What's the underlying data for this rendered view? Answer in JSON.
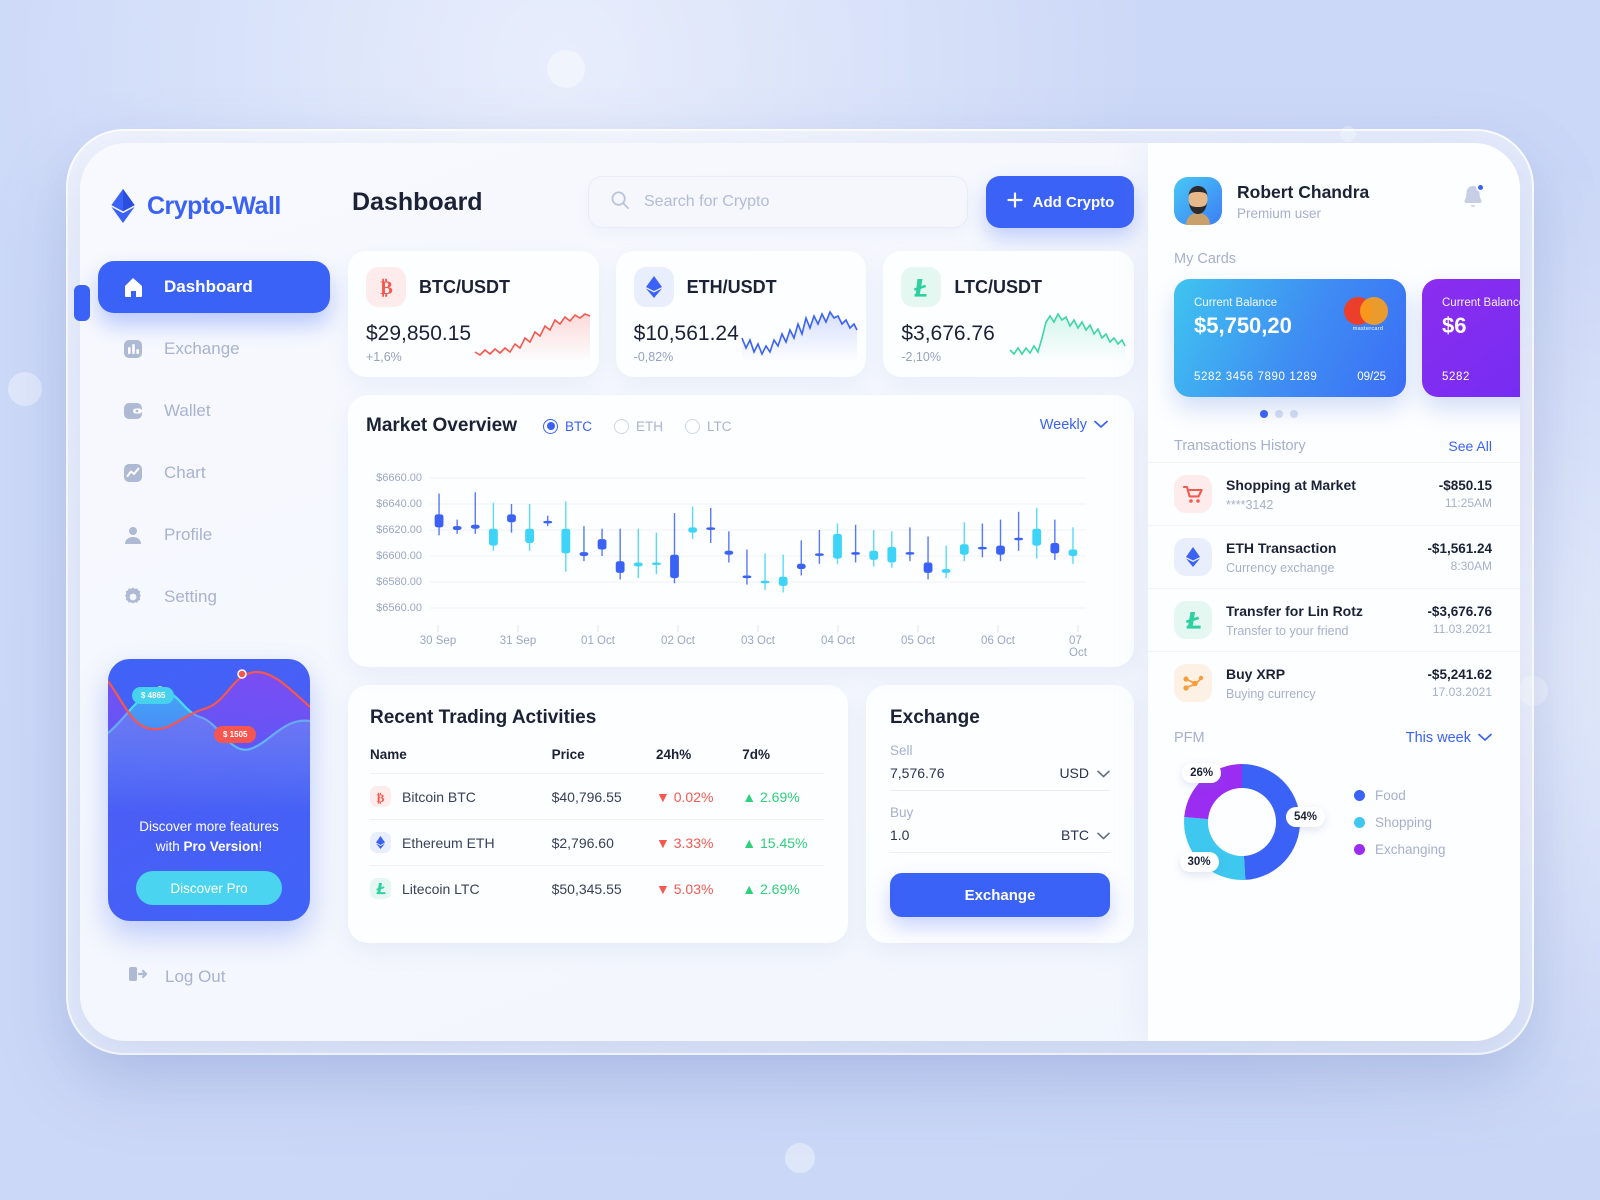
{
  "brand": {
    "name": "Crypto-Wall",
    "logo_icon": "ethereum-logo-icon",
    "accent": "#3b62f6"
  },
  "sidebar": {
    "items": [
      {
        "label": "Dashboard",
        "icon": "home-icon",
        "active": true
      },
      {
        "label": "Exchange",
        "icon": "bar-chart-icon",
        "active": false
      },
      {
        "label": "Wallet",
        "icon": "wallet-icon",
        "active": false
      },
      {
        "label": "Chart",
        "icon": "line-chart-icon",
        "active": false
      },
      {
        "label": "Profile",
        "icon": "user-icon",
        "active": false
      },
      {
        "label": "Setting",
        "icon": "gear-icon",
        "active": false
      }
    ],
    "promo": {
      "pill_high": "$ 4865",
      "pill_low": "$ 1505",
      "text_a": "Discover more features",
      "text_b": "with ",
      "text_bold": "Pro Version",
      "text_c": "!",
      "button": "Discover Pro"
    },
    "logout": {
      "label": "Log Out",
      "icon": "logout-icon"
    }
  },
  "header": {
    "title": "Dashboard",
    "search": {
      "placeholder": "Search for Crypto",
      "value": "",
      "icon": "search-icon"
    },
    "add_button": {
      "label": "Add Crypto",
      "icon": "plus-icon"
    }
  },
  "coin_cards": [
    {
      "pair": "BTC/USDT",
      "price": "$29,850.15",
      "change": "+1,6%",
      "icon": "bitcoin-icon",
      "color": "#f4584f",
      "bg": "#fdeceb"
    },
    {
      "pair": "ETH/USDT",
      "price": "$10,561.24",
      "change": "-0,82%",
      "icon": "ethereum-icon",
      "color": "#3b62f6",
      "bg": "#e9eefd"
    },
    {
      "pair": "LTC/USDT",
      "price": "$3,676.76",
      "change": "-2,10%",
      "icon": "litecoin-icon",
      "color": "#2ed0a0",
      "bg": "#e4f8f1"
    }
  ],
  "market": {
    "title": "Market Overview",
    "filters": [
      {
        "label": "BTC",
        "selected": true
      },
      {
        "label": "ETH",
        "selected": false
      },
      {
        "label": "LTC",
        "selected": false
      }
    ],
    "range": {
      "label": "Weekly",
      "icon": "chevron-down-icon"
    }
  },
  "chart_data": {
    "type": "candlestick",
    "title": "Market Overview",
    "xlabel": "",
    "ylabel": "",
    "ylim": [
      6550,
      6670
    ],
    "grid": true,
    "ytick_labels": [
      "$6660.00",
      "$6640.00",
      "$6620.00",
      "$6600.00",
      "$6580.00",
      "$6560.00"
    ],
    "ytick_values": [
      6660,
      6640,
      6620,
      6600,
      6580,
      6560
    ],
    "xtick_labels": [
      "30 Sep",
      "31 Sep",
      "01 Oct",
      "02 Oct",
      "03 Oct",
      "04 Oct",
      "05 Oct",
      "06 Oct",
      "07 Oct"
    ],
    "colors": {
      "up": "#3b62f6",
      "down": "#3ed4f7"
    },
    "candles": [
      {
        "open": 6622,
        "close": 6632,
        "high": 6648,
        "low": 6616,
        "dir": "up"
      },
      {
        "open": 6620,
        "close": 6623,
        "high": 6628,
        "low": 6617,
        "dir": "up"
      },
      {
        "open": 6621,
        "close": 6624,
        "high": 6649,
        "low": 6617,
        "dir": "up"
      },
      {
        "open": 6621,
        "close": 6608,
        "high": 6641,
        "low": 6604,
        "dir": "down"
      },
      {
        "open": 6626,
        "close": 6632,
        "high": 6640,
        "low": 6618,
        "dir": "up"
      },
      {
        "open": 6621,
        "close": 6610,
        "high": 6640,
        "low": 6604,
        "dir": "down"
      },
      {
        "open": 6627,
        "close": 6627,
        "high": 6631,
        "low": 6623,
        "dir": "up"
      },
      {
        "open": 6621,
        "close": 6602,
        "high": 6642,
        "low": 6588,
        "dir": "down"
      },
      {
        "open": 6603,
        "close": 6600,
        "high": 6623,
        "low": 6596,
        "dir": "up"
      },
      {
        "open": 6613,
        "close": 6605,
        "high": 6621,
        "low": 6600,
        "dir": "up"
      },
      {
        "open": 6596,
        "close": 6587,
        "high": 6621,
        "low": 6582,
        "dir": "up"
      },
      {
        "open": 6595,
        "close": 6592,
        "high": 6621,
        "low": 6583,
        "dir": "down"
      },
      {
        "open": 6595,
        "close": 6594,
        "high": 6618,
        "low": 6586,
        "dir": "down"
      },
      {
        "open": 6601,
        "close": 6583,
        "high": 6633,
        "low": 6579,
        "dir": "up"
      },
      {
        "open": 6622,
        "close": 6618,
        "high": 6638,
        "low": 6613,
        "dir": "down"
      },
      {
        "open": 6622,
        "close": 6621,
        "high": 6637,
        "low": 6610,
        "dir": "up"
      },
      {
        "open": 6604,
        "close": 6601,
        "high": 6619,
        "low": 6595,
        "dir": "up"
      },
      {
        "open": 6585,
        "close": 6583,
        "high": 6605,
        "low": 6578,
        "dir": "up"
      },
      {
        "open": 6581,
        "close": 6580,
        "high": 6602,
        "low": 6574,
        "dir": "down"
      },
      {
        "open": 6584,
        "close": 6577,
        "high": 6601,
        "low": 6572,
        "dir": "down"
      },
      {
        "open": 6594,
        "close": 6590,
        "high": 6612,
        "low": 6585,
        "dir": "up"
      },
      {
        "open": 6602,
        "close": 6601,
        "high": 6620,
        "low": 6594,
        "dir": "up"
      },
      {
        "open": 6617,
        "close": 6598,
        "high": 6625,
        "low": 6594,
        "dir": "down"
      },
      {
        "open": 6603,
        "close": 6601,
        "high": 6624,
        "low": 6595,
        "dir": "up"
      },
      {
        "open": 6604,
        "close": 6597,
        "high": 6620,
        "low": 6592,
        "dir": "down"
      },
      {
        "open": 6607,
        "close": 6595,
        "high": 6619,
        "low": 6591,
        "dir": "down"
      },
      {
        "open": 6603,
        "close": 6602,
        "high": 6622,
        "low": 6596,
        "dir": "up"
      },
      {
        "open": 6595,
        "close": 6587,
        "high": 6615,
        "low": 6582,
        "dir": "up"
      },
      {
        "open": 6590,
        "close": 6587,
        "high": 6608,
        "low": 6583,
        "dir": "down"
      },
      {
        "open": 6609,
        "close": 6601,
        "high": 6626,
        "low": 6596,
        "dir": "down"
      },
      {
        "open": 6607,
        "close": 6606,
        "high": 6625,
        "low": 6599,
        "dir": "up"
      },
      {
        "open": 6608,
        "close": 6601,
        "high": 6628,
        "low": 6596,
        "dir": "up"
      },
      {
        "open": 6614,
        "close": 6613,
        "high": 6634,
        "low": 6604,
        "dir": "up"
      },
      {
        "open": 6621,
        "close": 6608,
        "high": 6637,
        "low": 6598,
        "dir": "down"
      },
      {
        "open": 6610,
        "close": 6602,
        "high": 6628,
        "low": 6597,
        "dir": "up"
      },
      {
        "open": 6605,
        "close": 6600,
        "high": 6622,
        "low": 6594,
        "dir": "down"
      }
    ]
  },
  "recent_trading": {
    "title": "Recent Trading Activities",
    "columns": [
      "Name",
      "Price",
      "24h%",
      "7d%"
    ],
    "rows": [
      {
        "name": "Bitcoin BTC",
        "icon": "bitcoin-icon",
        "color": "#f4584f",
        "bg": "#fdeceb",
        "price": "$40,796.55",
        "h24": "0.02%",
        "h24_dir": "down",
        "d7": "2.69%",
        "d7_dir": "up"
      },
      {
        "name": "Ethereum ETH",
        "icon": "ethereum-icon",
        "color": "#3b62f6",
        "bg": "#e9eefd",
        "price": "$2,796.60",
        "h24": "3.33%",
        "h24_dir": "down",
        "d7": "15.45%",
        "d7_dir": "up"
      },
      {
        "name": "Litecoin LTC",
        "icon": "litecoin-icon",
        "color": "#2ed0a0",
        "bg": "#e4f8f1",
        "price": "$50,345.55",
        "h24": "5.03%",
        "h24_dir": "down",
        "d7": "2.69%",
        "d7_dir": "up"
      }
    ]
  },
  "exchange": {
    "title": "Exchange",
    "sell_label": "Sell",
    "sell_value": "7,576.76",
    "sell_currency": "USD",
    "buy_label": "Buy",
    "buy_value": "1.0",
    "buy_currency": "BTC",
    "button": "Exchange"
  },
  "profile": {
    "name": "Robert Chandra",
    "role": "Premium user",
    "avatar_icon": "avatar",
    "bell_icon": "bell-icon"
  },
  "cards": {
    "section_label": "My Cards",
    "items": [
      {
        "balance_label": "Current Balance",
        "balance": "$5,750,20",
        "number": "5282 3456 7890 1289",
        "expiry": "09/25",
        "brand": "mastercard"
      },
      {
        "balance_label": "Current Balance",
        "balance": "$6",
        "number": "5282",
        "expiry": "",
        "brand": ""
      }
    ],
    "active_dot": 0,
    "dot_count": 3
  },
  "transactions": {
    "title": "Transactions History",
    "see_all": "See All",
    "items": [
      {
        "title": "Shopping at Market",
        "subtitle": "****3142",
        "amount": "-$850.15",
        "time": "11:25AM",
        "icon": "shopping-cart-icon",
        "color": "#f4584f",
        "bg": "#fdeceb"
      },
      {
        "title": "ETH Transaction",
        "subtitle": "Currency exchange",
        "amount": "-$1,561.24",
        "time": "8:30AM",
        "icon": "ethereum-icon",
        "color": "#3b62f6",
        "bg": "#e9eefd"
      },
      {
        "title": "Transfer for Lin Rotz",
        "subtitle": "Transfer to your friend",
        "amount": "-$3,676.76",
        "time": "11.03.2021",
        "icon": "litecoin-icon",
        "color": "#2ed0a0",
        "bg": "#e4f8f1"
      },
      {
        "title": "Buy XRP",
        "subtitle": "Buying currency",
        "amount": "-$5,241.62",
        "time": "17.03.2021",
        "icon": "ripple-icon",
        "color": "#f79e3b",
        "bg": "#fdf0e5"
      }
    ]
  },
  "pfm": {
    "title": "PFM",
    "range": {
      "label": "This week",
      "icon": "chevron-down-icon"
    },
    "chart_data": {
      "type": "pie",
      "title": "PFM",
      "categories": [
        "Food",
        "Shopping",
        "Exchanging"
      ],
      "values": [
        54,
        30,
        26
      ],
      "labels": [
        "54%",
        "30%",
        "26%"
      ],
      "colors": [
        "#3b62f6",
        "#3ec8f0",
        "#9b2df2"
      ],
      "legend_position": "right",
      "donut": true
    }
  }
}
